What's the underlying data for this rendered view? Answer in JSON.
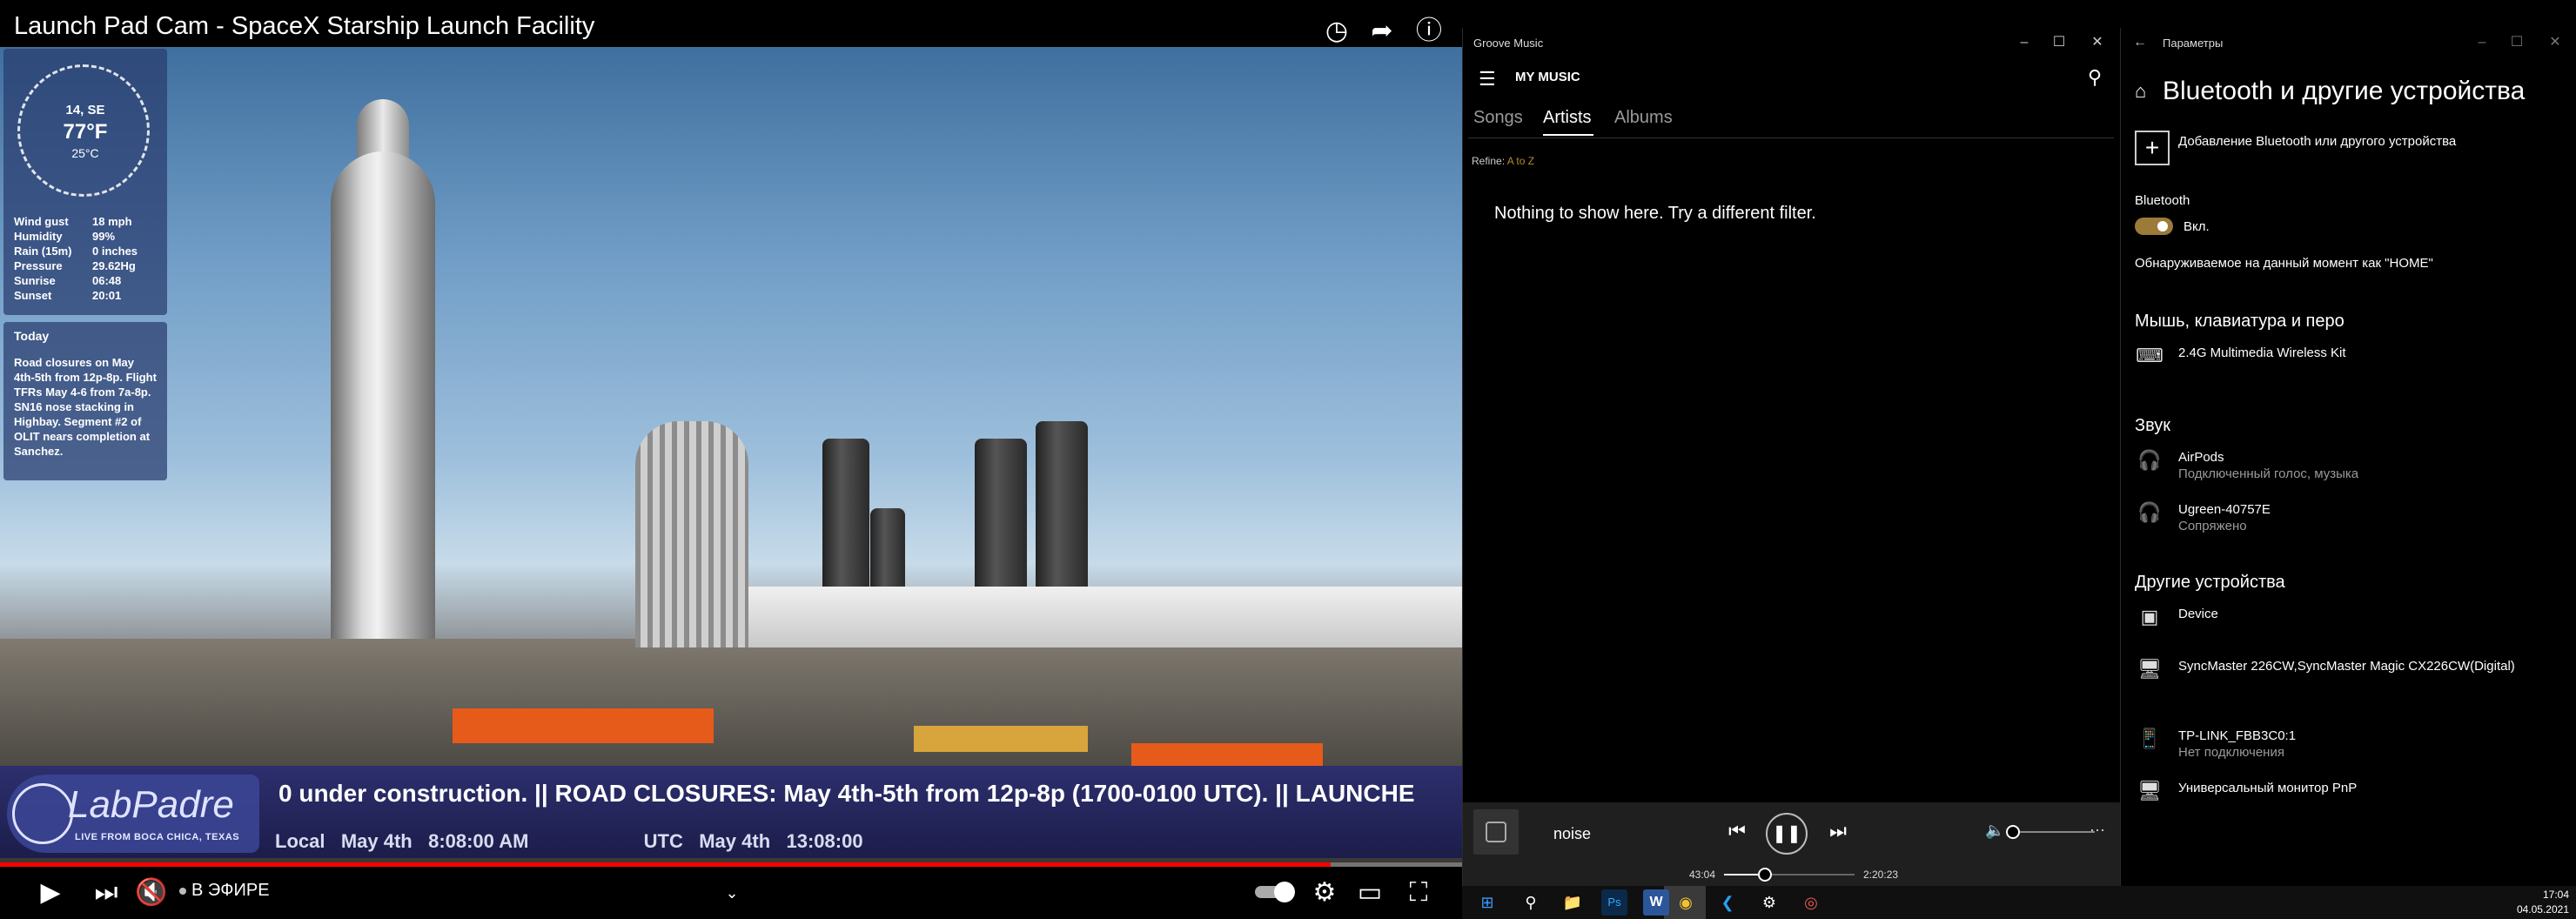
{
  "youtube": {
    "title": "Launch Pad Cam - SpaceX Starship Launch Facility",
    "weather": {
      "wind_dir": "14, SE",
      "temp_f": "77°F",
      "temp_c": "25°C",
      "rows": [
        {
          "k": "Wind gust",
          "v": "18 mph"
        },
        {
          "k": "Humidity",
          "v": "99%"
        },
        {
          "k": "Rain (15m)",
          "v": "0 inches"
        },
        {
          "k": "Pressure",
          "v": "29.62Hg"
        },
        {
          "k": "Sunrise",
          "v": "06:48"
        },
        {
          "k": "Sunset",
          "v": "20:01"
        }
      ]
    },
    "today": {
      "heading": "Today",
      "body": "Road closures on May 4th-5th from 12p-8p. Flight TFRs May 4-6 from 7a-8p. SN16 nose stacking in Highbay. Segment #2 of OLIT nears completion at Sanchez."
    },
    "ticker": {
      "logo": "LabPadre",
      "logo_sub": "LIVE FROM BOCA CHICA, TEXAS",
      "scroll_text": "0 under construction. || ROAD CLOSURES: May 4th-5th from 12p-8p (1700-0100 UTC). || LAUNCHE",
      "local_label": "Local",
      "local_date": "May 4th",
      "local_time": "8:08:00  AM",
      "utc_label": "UTC",
      "utc_date": "May 4th",
      "utc_time": "13:08:00"
    },
    "progress": 0.91,
    "live_label": "В ЭФИРЕ"
  },
  "groove": {
    "app_title": "Groove Music",
    "header": "MY MUSIC",
    "tabs": [
      "Songs",
      "Artists",
      "Albums"
    ],
    "active_tab": "Artists",
    "refine_label": "Refine:",
    "refine_value": "A to Z",
    "empty_message": "Nothing to show here. Try a different filter.",
    "player": {
      "song": "noise",
      "elapsed": "43:04",
      "duration": "2:20:23",
      "seek_fraction": 0.31,
      "volume_fraction": 0.0
    }
  },
  "settings": {
    "app_title": "Параметры",
    "title": "Bluetooth и другие устройства",
    "add_device": "Добавление Bluetooth или другого устройства",
    "bt_label": "Bluetooth",
    "bt_state": "Вкл.",
    "discoverable": "Обнаруживаемое на данный момент как \"HOME\"",
    "sections": [
      {
        "title": "Мышь, клавиатура и перо",
        "items": [
          {
            "icon": "keyboard-icon",
            "name": "2.4G Multimedia Wireless Kit",
            "sub": ""
          }
        ]
      },
      {
        "title": "Звук",
        "items": [
          {
            "icon": "headphones-icon",
            "name": "AirPods",
            "sub": "Подключенный голос, музыка"
          },
          {
            "icon": "headphones-icon",
            "name": "Ugreen-40757E",
            "sub": "Сопряжено"
          }
        ]
      },
      {
        "title": "Другие устройства",
        "items": [
          {
            "icon": "device-icon",
            "name": "Device",
            "sub": ""
          },
          {
            "icon": "monitor-icon",
            "name": "SyncMaster 226CW,SyncMaster Magic CX226CW(Digital)",
            "sub": ""
          },
          {
            "icon": "phone-icon",
            "name": "TP-LINK_FBB3C0:1",
            "sub": "Нет подключения"
          },
          {
            "icon": "monitor-icon",
            "name": "Универсальный монитор PnP",
            "sub": ""
          }
        ]
      }
    ]
  },
  "taskbar": {
    "time": "17:04",
    "date": "04.05.2021"
  },
  "colors": {
    "accent_gold": "#9b7a3a",
    "youtube_red": "#ff0000"
  }
}
